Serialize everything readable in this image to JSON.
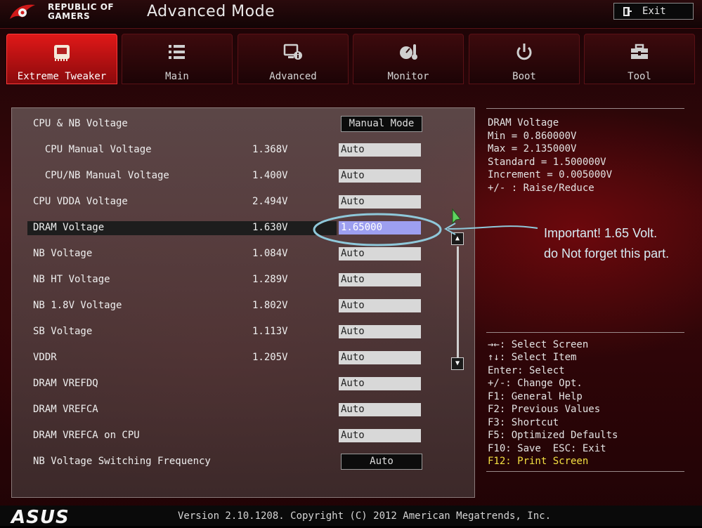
{
  "app": {
    "brand_line1": "REPUBLIC OF",
    "brand_line2": "GAMERS",
    "title": "Advanced Mode",
    "exit_label": "Exit"
  },
  "tabs": [
    {
      "label": "Extreme Tweaker",
      "icon": "ram-chip-icon",
      "active": true
    },
    {
      "label": "Main",
      "icon": "list-icon",
      "active": false
    },
    {
      "label": "Advanced",
      "icon": "monitor-info-icon",
      "active": false
    },
    {
      "label": "Monitor",
      "icon": "gauge-thermometer-icon",
      "active": false
    },
    {
      "label": "Boot",
      "icon": "power-icon",
      "active": false
    },
    {
      "label": "Tool",
      "icon": "toolbox-icon",
      "active": false
    }
  ],
  "settings": {
    "header_row": {
      "label": "CPU & NB Voltage",
      "mode": "Manual Mode"
    },
    "rows": [
      {
        "label": "  CPU Manual Voltage",
        "value": "1.368V",
        "setting": "Auto"
      },
      {
        "label": "  CPU/NB Manual Voltage",
        "value": "1.400V",
        "setting": "Auto"
      },
      {
        "label": "CPU VDDA Voltage",
        "value": "2.494V",
        "setting": "Auto"
      },
      {
        "label": "DRAM Voltage",
        "value": "1.630V",
        "setting": "1.65000"
      },
      {
        "label": "NB Voltage",
        "value": "1.084V",
        "setting": "Auto"
      },
      {
        "label": "NB HT Voltage",
        "value": "1.289V",
        "setting": "Auto"
      },
      {
        "label": "NB 1.8V Voltage",
        "value": "1.802V",
        "setting": "Auto"
      },
      {
        "label": "SB Voltage",
        "value": "1.113V",
        "setting": "Auto"
      },
      {
        "label": "VDDR",
        "value": "1.205V",
        "setting": "Auto"
      },
      {
        "label": "DRAM VREFDQ",
        "value": "",
        "setting": "Auto"
      },
      {
        "label": "DRAM VREFCA",
        "value": "",
        "setting": "Auto"
      },
      {
        "label": "DRAM VREFCA on CPU",
        "value": "",
        "setting": "Auto"
      }
    ],
    "footer_row": {
      "label": "NB Voltage Switching Frequency",
      "mode": "Auto"
    }
  },
  "help_info": [
    "DRAM Voltage",
    "Min = 0.860000V",
    "Max = 2.135000V",
    "Standard = 1.500000V",
    "Increment = 0.005000V",
    "+/- : Raise/Reduce"
  ],
  "help_keys": [
    "→←: Select Screen",
    "↑↓: Select Item",
    "Enter: Select",
    "+/-: Change Opt.",
    "F1: General Help",
    "F2: Previous Values",
    "F3: Shortcut",
    "F5: Optimized Defaults",
    "F10: Save  ESC: Exit"
  ],
  "help_print": "F12: Print Screen",
  "footer": {
    "logo": "ASUS",
    "version": "Version 2.10.1208. Copyright (C) 2012 American Megatrends, Inc."
  },
  "annotation": {
    "line1": "Important! 1.65 Volt.",
    "line2": "do Not forget this part.",
    "color": "#8fc8da"
  }
}
